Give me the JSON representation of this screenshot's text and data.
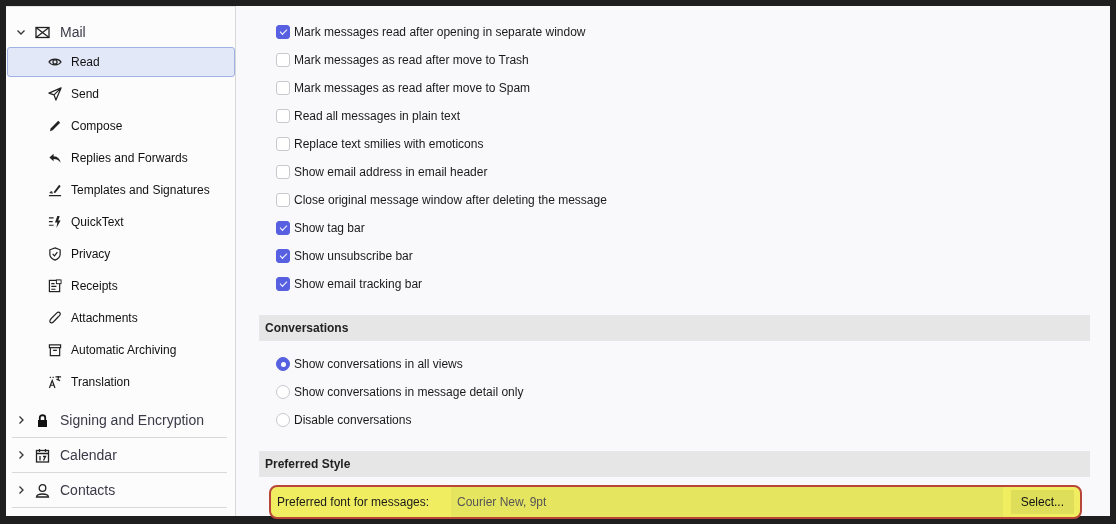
{
  "sidebar": {
    "groups": [
      {
        "label": "Mail",
        "expanded": true,
        "children": [
          {
            "label": "Read",
            "selected": true
          },
          {
            "label": "Send",
            "selected": false
          },
          {
            "label": "Compose",
            "selected": false
          },
          {
            "label": "Replies and Forwards",
            "selected": false
          },
          {
            "label": "Templates and Signatures",
            "selected": false
          },
          {
            "label": "QuickText",
            "selected": false
          },
          {
            "label": "Privacy",
            "selected": false
          },
          {
            "label": "Receipts",
            "selected": false
          },
          {
            "label": "Attachments",
            "selected": false
          },
          {
            "label": "Automatic Archiving",
            "selected": false
          },
          {
            "label": "Translation",
            "selected": false
          }
        ]
      },
      {
        "label": "Signing and Encryption",
        "expanded": false
      },
      {
        "label": "Calendar",
        "expanded": false
      },
      {
        "label": "Contacts",
        "expanded": false
      }
    ]
  },
  "options": [
    {
      "label": "Mark messages read after opening in separate window",
      "checked": true
    },
    {
      "label": "Mark messages as read after move to Trash",
      "checked": false
    },
    {
      "label": "Mark messages as read after move to Spam",
      "checked": false
    },
    {
      "label": "Read all messages in plain text",
      "checked": false
    },
    {
      "label": "Replace text smilies with emoticons",
      "checked": false
    },
    {
      "label": "Show email address in email header",
      "checked": false
    },
    {
      "label": "Close original message window after deleting the message",
      "checked": false
    },
    {
      "label": "Show tag bar",
      "checked": true
    },
    {
      "label": "Show unsubscribe bar",
      "checked": true
    },
    {
      "label": "Show email tracking bar",
      "checked": true
    }
  ],
  "conversations": {
    "title": "Conversations",
    "options": [
      {
        "label": "Show conversations in all views",
        "selected": true
      },
      {
        "label": "Show conversations in message detail only",
        "selected": false
      },
      {
        "label": "Disable conversations",
        "selected": false
      }
    ]
  },
  "preferred_style": {
    "title": "Preferred Style",
    "font_label": "Preferred font for messages:",
    "font_value": "Courier New, 9pt",
    "select_button": "Select...",
    "highlighted": true
  }
}
